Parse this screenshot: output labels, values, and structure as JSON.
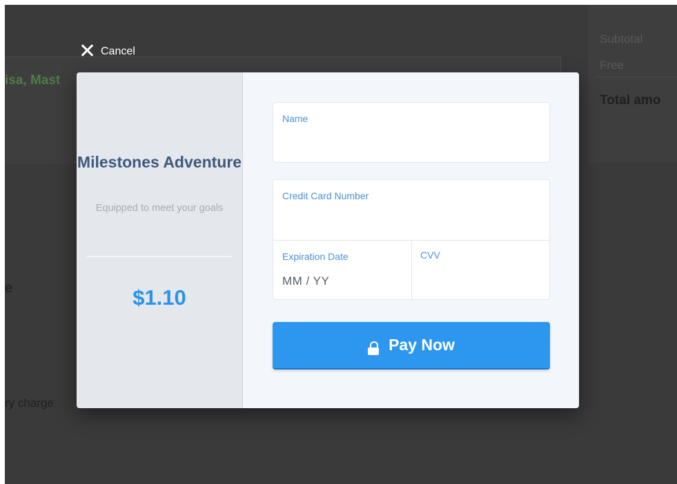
{
  "background": {
    "left_text_partial": "isa, Mast",
    "left_fragment_e": "e",
    "left_fragment_charge": "ry charge",
    "summary": {
      "subtotal_label": "Subtotal",
      "free_label": "Free",
      "total_label": "Total amo"
    }
  },
  "cancel": {
    "label": "Cancel",
    "icon": "close-icon"
  },
  "merchant": {
    "name": "Milestones Adventure",
    "tagline": "Equipped to meet your goals",
    "amount": "$1.10"
  },
  "form": {
    "name_label": "Name",
    "card_number_label": "Credit Card Number",
    "expiration_label": "Expiration Date",
    "expiration_value": "MM  /  YY",
    "cvv_label": "CVV"
  },
  "pay_button": {
    "label": "Pay Now",
    "icon": "lock-icon"
  },
  "colors": {
    "accent": "#2d97ef",
    "merchant_text": "#3d5a7c",
    "field_label": "#4a90d9",
    "overlay": "#3a3a3a"
  }
}
